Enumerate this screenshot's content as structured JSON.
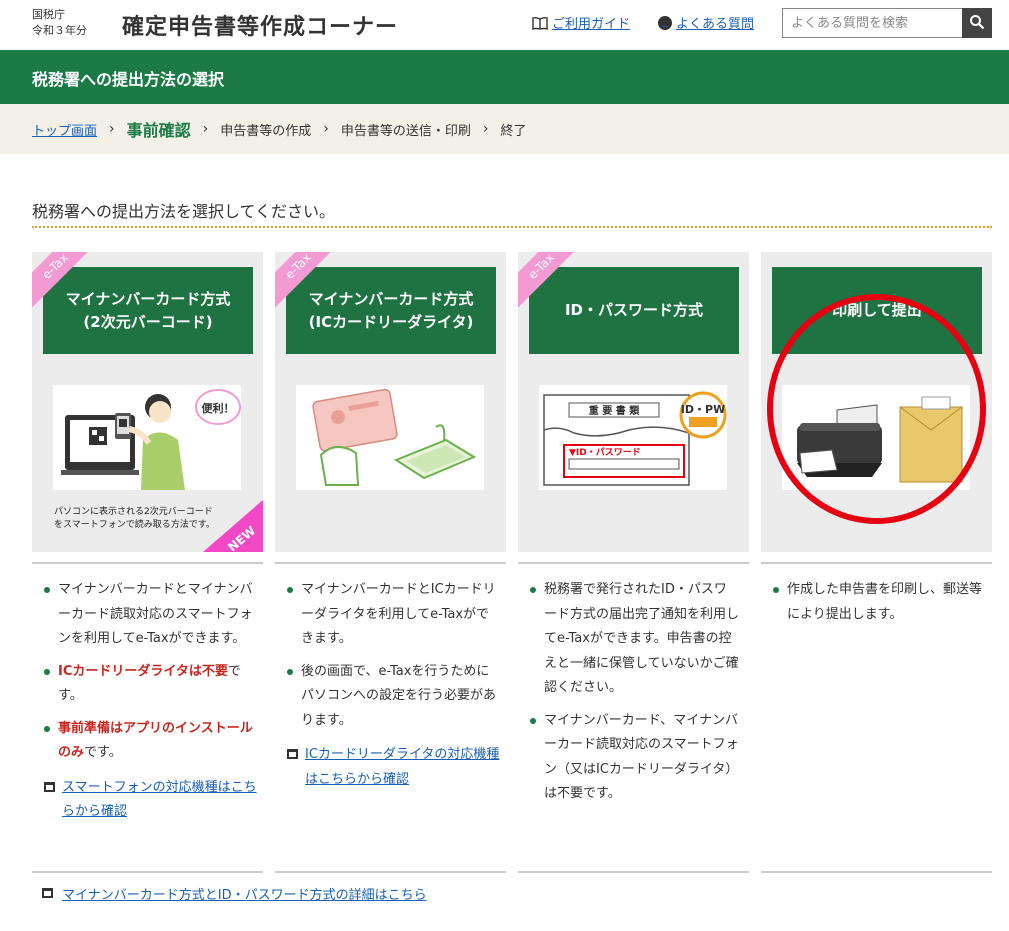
{
  "header": {
    "agency": "国税庁",
    "year": "令和３年分",
    "title": "確定申告書等作成コーナー",
    "guide_link": "ご利用ガイド",
    "faq_link": "よくある質問",
    "search_placeholder": "よくある質問を検索"
  },
  "band": {
    "title": "税務署への提出方法の選択"
  },
  "breadcrumb": {
    "items": [
      "トップ画面",
      "事前確認",
      "申告書等の作成",
      "申告書等の送信・印刷",
      "終了"
    ],
    "current_index": 1
  },
  "instruction": "税務署への提出方法を選択してください。",
  "cards": [
    {
      "badge": "e-Tax",
      "title_line1": "マイナンバーカード方式",
      "title_line2": "(2次元バーコード)",
      "caption_line1": "パソコンに表示される2次元バーコード",
      "caption_line2": "をスマートフォンで読み取る方法です。",
      "new_badge": "NEW",
      "bubble": "便利！"
    },
    {
      "badge": "e-Tax",
      "title_line1": "マイナンバーカード方式",
      "title_line2": "(ICカードリーダライタ)"
    },
    {
      "badge": "e-Tax",
      "title_line1": "ID・パスワード方式",
      "img_heading": "重 要 書 類",
      "img_label": "▼ID・パスワード",
      "img_badge": "ID・PW が目印"
    },
    {
      "title_line1": "印刷して提出"
    }
  ],
  "columns": [
    {
      "items": [
        {
          "parts": [
            {
              "text": "マイナンバーカードとマイナンバーカード読取対応のスマートフォンを利用してe-Taxができます。",
              "red": false
            }
          ]
        },
        {
          "parts": [
            {
              "text": "ICカードリーダライタは不要",
              "red": true
            },
            {
              "text": "です。",
              "red": false
            }
          ]
        },
        {
          "parts": [
            {
              "text": "事前準備はアプリのインストールのみ",
              "red": true
            },
            {
              "text": "です。",
              "red": false
            }
          ]
        }
      ],
      "link": "スマートフォンの対応機種はこちらから確認"
    },
    {
      "items": [
        {
          "parts": [
            {
              "text": "マイナンバーカードとICカードリーダライタを利用してe-Taxができます。",
              "red": false
            }
          ]
        },
        {
          "parts": [
            {
              "text": "後の画面で、e-Taxを行うためにパソコンへの設定を行う必要があります。",
              "red": false
            }
          ]
        }
      ],
      "link": "ICカードリーダライタの対応機種はこちらから確認"
    },
    {
      "items": [
        {
          "parts": [
            {
              "text": "税務署で発行されたID・パスワード方式の届出完了通知を利用してe-Taxができます。",
              "red": false
            },
            {
              "text": "申告書の控えと一緒に保管していないかご確認ください。",
              "red": false,
              "small": true
            }
          ]
        },
        {
          "parts": [
            {
              "text": "マイナンバーカード、マイナンバーカード読取対応のスマートフォン（又はICカードリーダライタ）は不要です。",
              "red": false
            }
          ]
        }
      ]
    },
    {
      "items": [
        {
          "parts": [
            {
              "text": "作成した申告書を印刷し、郵送等により提出します。",
              "red": false
            }
          ]
        }
      ]
    }
  ],
  "footer_link": "マイナンバーカード方式とID・パスワード方式の詳細はこちら",
  "colors": {
    "header_green": "#1b7a46",
    "card_head_green": "#1f7242",
    "etax_pink": "#f39ad3",
    "new_magenta": "#f248c6",
    "highlight_red": "#e60012",
    "link_blue": "#1a5fb4",
    "breadcrumb_bg": "#f3f0e7"
  }
}
